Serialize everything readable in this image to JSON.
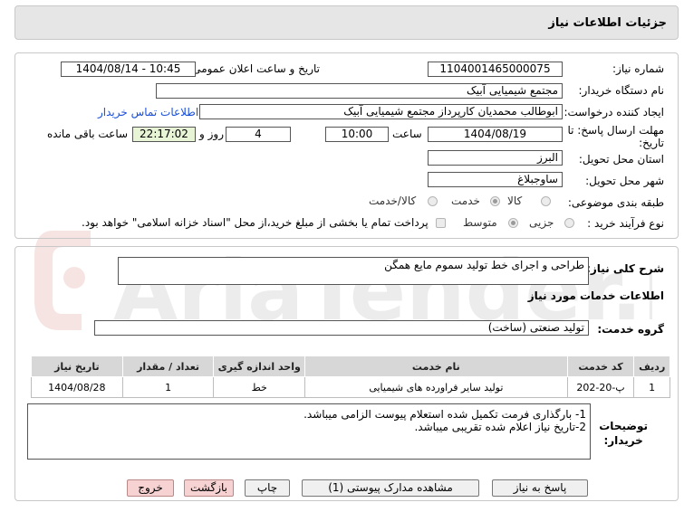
{
  "header": {
    "title": "جزئیات اطلاعات نیاز"
  },
  "form": {
    "need_number_label": "شماره نیاز:",
    "need_number": "1104001465000075",
    "announce_label": "تاریخ و ساعت اعلان عمومی:",
    "announce_value": "1404/08/14 - 10:45",
    "buyer_org_label": "نام دستگاه خریدار:",
    "buyer_org": "مجتمع شیمیایی آبیک",
    "creator_label": "ایجاد کننده درخواست:",
    "creator": "ابوطالب محمدیان کارپرداز مجتمع شیمیایی آبیک",
    "contact_link": "اطلاعات تماس خریدار",
    "deadline_label_line1": "مهلت ارسال پاسخ: تا",
    "deadline_label_line2": "تاریخ:",
    "deadline_date": "1404/08/19",
    "time_label": "ساعت",
    "deadline_time": "10:00",
    "days_value": "4",
    "days_label": "روز و",
    "remaining_time": "22:17:02",
    "remaining_label": "ساعت باقی مانده",
    "province_label": "استان محل تحویل:",
    "province": "البرز",
    "city_label": "شهر محل تحویل:",
    "city": "ساوجبلاغ",
    "category_label": "طبقه بندی موضوعی:",
    "category_options": [
      "کالا",
      "خدمت",
      "کالا/خدمت"
    ],
    "category_selected": "خدمت",
    "process_label": "نوع فرآیند خرید :",
    "process_options": [
      "جزیی",
      "متوسط"
    ],
    "process_selected": "متوسط",
    "payment_note": "پرداخت تمام یا بخشی از مبلغ خرید،از محل \"اسناد خزانه اسلامی\" خواهد بود."
  },
  "summary": {
    "label": "شرح کلی نیاز:",
    "value": "طراحی و اجرای خط تولید سموم مایع همگن"
  },
  "services": {
    "section_title": "اطلاعات خدمات مورد نیاز",
    "group_label": "گروه خدمت:",
    "group_value": "تولید صنعتی (ساخت)",
    "columns": [
      "ردیف",
      "کد خدمت",
      "نام خدمت",
      "واحد اندازه گیری",
      "تعداد / مقدار",
      "تاریخ نیاز"
    ],
    "rows": [
      [
        "1",
        "پ-20-202",
        "تولید سایر فراورده های شیمیایی",
        "خط",
        "1",
        "1404/08/28"
      ]
    ]
  },
  "notes": {
    "label_line1": "توضیحات",
    "label_line2": "خریدار:",
    "line1": "1- بارگذاری فرمت تکمیل شده استعلام پیوست الزامی میباشد.",
    "line2": "2-تاریخ نیاز اعلام شده تقریبی میباشد."
  },
  "buttons": {
    "reply": "پاسخ به نیاز",
    "attachments": "مشاهده مدارک پیوستی (1)",
    "print": "چاپ",
    "back": "بازگشت",
    "exit": "خروج"
  },
  "watermark_text": "AriaTender.net",
  "colors": {
    "link": "#1a4fd6",
    "header_bg": "#e6e6e6"
  }
}
